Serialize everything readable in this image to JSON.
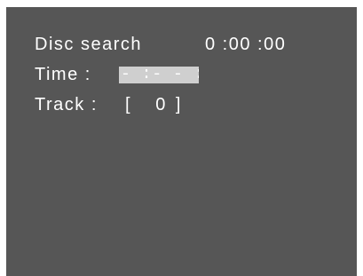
{
  "osd": {
    "title": "Disc search",
    "elapsed": "0 :00 :00",
    "time_label": "Time :",
    "time_value": "- :- - :- -",
    "track_label": "Track :",
    "track_value": "[   0 ]"
  },
  "colors": {
    "background": "#565656",
    "text": "#ffffff",
    "highlight": "#cfcfcf"
  }
}
